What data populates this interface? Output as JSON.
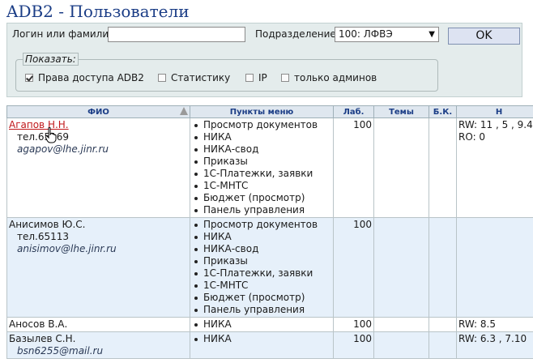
{
  "header": {
    "title": "ADB2 - Пользователи"
  },
  "filters": {
    "login_label": "Логин или фамилия:",
    "login_value": "",
    "department_label": "Подразделение:",
    "department_value": "100: ЛФВЭ",
    "ok_label": "OK",
    "show_legend": "Показать:",
    "checkboxes": [
      {
        "label": "Права доступа ADB2",
        "checked": true
      },
      {
        "label": "Статистику",
        "checked": false
      },
      {
        "label": "IP",
        "checked": false
      },
      {
        "label": "только админов",
        "checked": false
      }
    ]
  },
  "table": {
    "columns": [
      "ФИО",
      "Пункты меню",
      "Лаб.",
      "Темы",
      "Б.К.",
      "Н"
    ],
    "rows": [
      {
        "name": "Агапов Н.Н.",
        "phone": "тел.65169",
        "email": "agapov@lhe.jinr.ru",
        "menu": [
          "Просмотр документов",
          "НИКА",
          "НИКА-свод",
          "Приказы",
          "1С-Платежки, заявки",
          "1С-МНТС",
          "Бюджет (просмотр)",
          "Панель управления"
        ],
        "lab": "100",
        "access": [
          "RW: 11 , 5 , 9.4",
          "RO: 0"
        ]
      },
      {
        "name": "Анисимов Ю.С.",
        "phone": "тел.65113",
        "email": "anisimov@lhe.jinr.ru",
        "menu": [
          "Просмотр документов",
          "НИКА",
          "НИКА-свод",
          "Приказы",
          "1С-Платежки, заявки",
          "1С-МНТС",
          "Бюджет (просмотр)",
          "Панель управления"
        ],
        "lab": "100",
        "access": []
      },
      {
        "name": "Аносов В.А.",
        "menu": [
          "НИКА"
        ],
        "lab": "100",
        "access": [
          "RW: 8.5"
        ]
      },
      {
        "name": "Базылев С.Н.",
        "email": "bsn6255@mail.ru",
        "menu": [
          "НИКА"
        ],
        "lab": "100",
        "access": [
          "RW: 6.3 , 7.10"
        ]
      }
    ]
  }
}
